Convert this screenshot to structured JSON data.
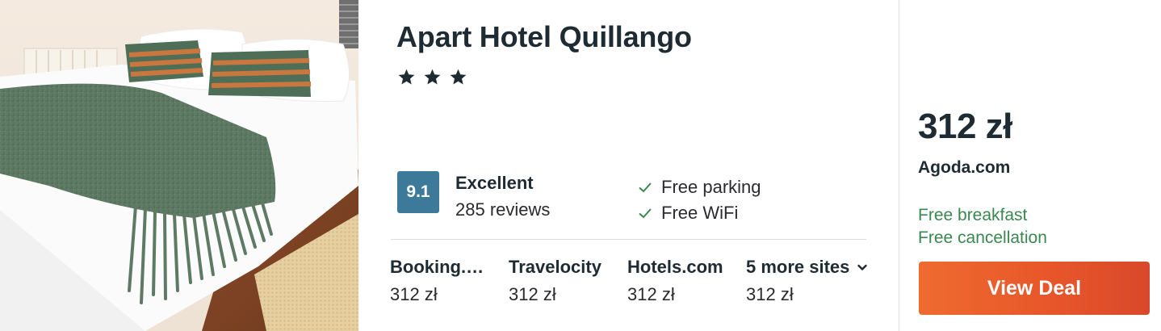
{
  "hotel": {
    "name": "Apart Hotel Quillango",
    "star_count": 3,
    "photo_icon": "hotel-room-bed-photo"
  },
  "rating": {
    "score": "9.1",
    "label": "Excellent",
    "reviews": "285 reviews",
    "badge_color": "#3d7a9a"
  },
  "amenities": [
    {
      "icon": "check-icon",
      "label": "Free parking"
    },
    {
      "icon": "check-icon",
      "label": "Free WiFi"
    }
  ],
  "other_sites": [
    {
      "name": "Booking.…",
      "price": "312 zł"
    },
    {
      "name": "Travelocity",
      "price": "312 zł"
    },
    {
      "name": "Hotels.com",
      "price": "312 zł"
    },
    {
      "name": "5 more sites",
      "price": "312 zł",
      "icon": "chevron-down-icon"
    }
  ],
  "deal": {
    "price": "312 zł",
    "provider": "Agoda.com",
    "perks": [
      "Free breakfast",
      "Free cancellation"
    ],
    "button_label": "View Deal",
    "perk_color": "#3a8750",
    "button_color": "#e8572a"
  }
}
